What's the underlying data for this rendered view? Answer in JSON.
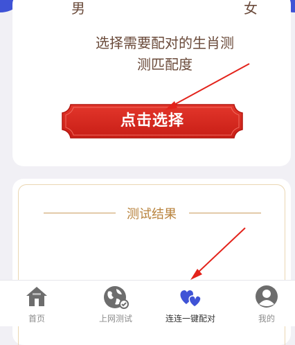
{
  "selection_card": {
    "male_label": "男",
    "female_label": "女",
    "instruction_line1": "选择需要配对的生肖测",
    "instruction_line2": "测匹配度",
    "choose_button_label": "点击选择"
  },
  "result_card": {
    "title": "测试结果"
  },
  "tabbar": {
    "items": [
      {
        "label": "首页",
        "icon": "home-icon"
      },
      {
        "label": "上网测试",
        "icon": "globe-icon"
      },
      {
        "label": "连连一键配对",
        "icon": "hearts-icon"
      },
      {
        "label": "我的",
        "icon": "user-icon"
      }
    ],
    "active_index": 2
  },
  "colors": {
    "accent_blue": "#3f53d6",
    "button_red": "#d9261c",
    "gold": "#b8823c",
    "text_brown": "#6a4a3a"
  }
}
